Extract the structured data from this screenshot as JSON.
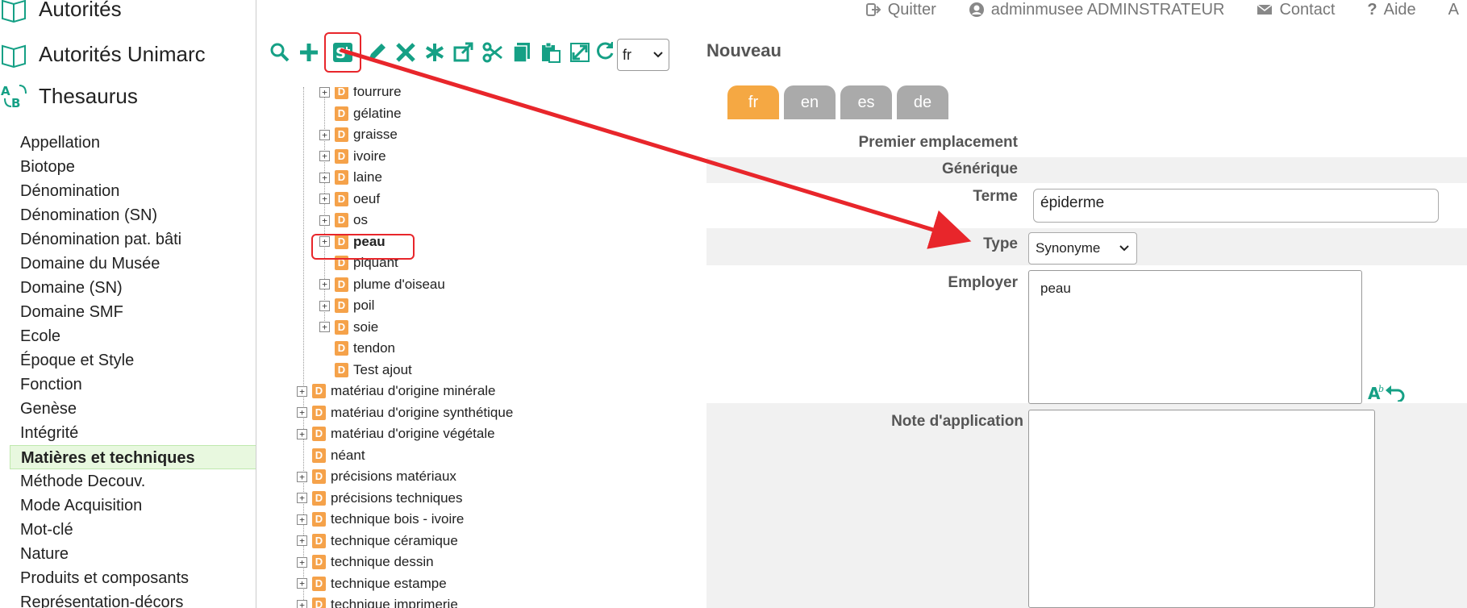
{
  "topnav": {
    "quit": "Quitter",
    "user": "adminmusee ADMINSTRATEUR",
    "contact": "Contact",
    "help": "Aide",
    "extra": "A"
  },
  "sidebar": {
    "modules": [
      {
        "label": "Autorités",
        "icon": "book-icon"
      },
      {
        "label": "Autorités Unimarc",
        "icon": "book-icon"
      },
      {
        "label": "Thesaurus",
        "icon": "thesaurus-icon"
      }
    ],
    "authorities": [
      "Appellation",
      "Biotope",
      "Dénomination",
      "Dénomination (SN)",
      "Dénomination pat. bâti",
      "Domaine du Musée",
      "Domaine (SN)",
      "Domaine SMF",
      "Ecole",
      "Époque et Style",
      "Fonction",
      "Genèse",
      "Intégrité",
      "Matières et techniques",
      "Méthode Decouv.",
      "Mode Acquisition",
      "Mot-clé",
      "Nature",
      "Produits et composants",
      "Représentation-décors"
    ],
    "selected": "Matières et techniques"
  },
  "toolbar": {
    "language": "fr",
    "buttons": [
      "search-icon",
      "add-icon",
      "add-synonym-icon",
      "edit-icon",
      "delete-icon",
      "asterisk-icon",
      "open-icon",
      "cut-icon",
      "copy-icon",
      "paste-icon",
      "move-icon"
    ]
  },
  "tree": {
    "children": [
      {
        "label": "fourrure",
        "expandable": true
      },
      {
        "label": "gélatine",
        "expandable": false
      },
      {
        "label": "graisse",
        "expandable": true
      },
      {
        "label": "ivoire",
        "expandable": true
      },
      {
        "label": "laine",
        "expandable": true
      },
      {
        "label": "oeuf",
        "expandable": true
      },
      {
        "label": "os",
        "expandable": true
      },
      {
        "label": "peau",
        "expandable": true,
        "selected": true
      },
      {
        "label": "piquant",
        "expandable": false
      },
      {
        "label": "plume d'oiseau",
        "expandable": true
      },
      {
        "label": "poil",
        "expandable": true
      },
      {
        "label": "soie",
        "expandable": true
      },
      {
        "label": "tendon",
        "expandable": false
      },
      {
        "label": "Test ajout",
        "expandable": false
      }
    ],
    "siblings": [
      {
        "label": "matériau d'origine minérale",
        "expandable": true
      },
      {
        "label": "matériau d'origine synthétique",
        "expandable": true
      },
      {
        "label": "matériau d'origine végétale",
        "expandable": true
      },
      {
        "label": "néant",
        "expandable": false
      },
      {
        "label": "précisions matériaux",
        "expandable": true
      },
      {
        "label": "précisions techniques",
        "expandable": true
      },
      {
        "label": "technique bois - ivoire",
        "expandable": true
      },
      {
        "label": "technique céramique",
        "expandable": true
      },
      {
        "label": "technique dessin",
        "expandable": true
      },
      {
        "label": "technique estampe",
        "expandable": true
      },
      {
        "label": "technique imprimerie",
        "expandable": true
      }
    ],
    "node_icon_letter": "D"
  },
  "form": {
    "title": "Nouveau",
    "tabs": [
      "fr",
      "en",
      "es",
      "de"
    ],
    "active_tab": "fr",
    "first_location_label": "Premier emplacement",
    "generic_label": "Générique",
    "term_label": "Terme",
    "term_value": "épiderme",
    "type_label": "Type",
    "type_value": "Synonyme",
    "employ_label": "Employer",
    "employ_value": "peau",
    "note_label": "Note d'application",
    "note_value": ""
  },
  "colors": {
    "accent": "#15a085",
    "tab_active": "#f5a843",
    "tab_inactive": "#aaaaaa",
    "highlight": "#e8262b",
    "node_icon": "#f5a24a",
    "selected_row": "#e8f8df"
  }
}
